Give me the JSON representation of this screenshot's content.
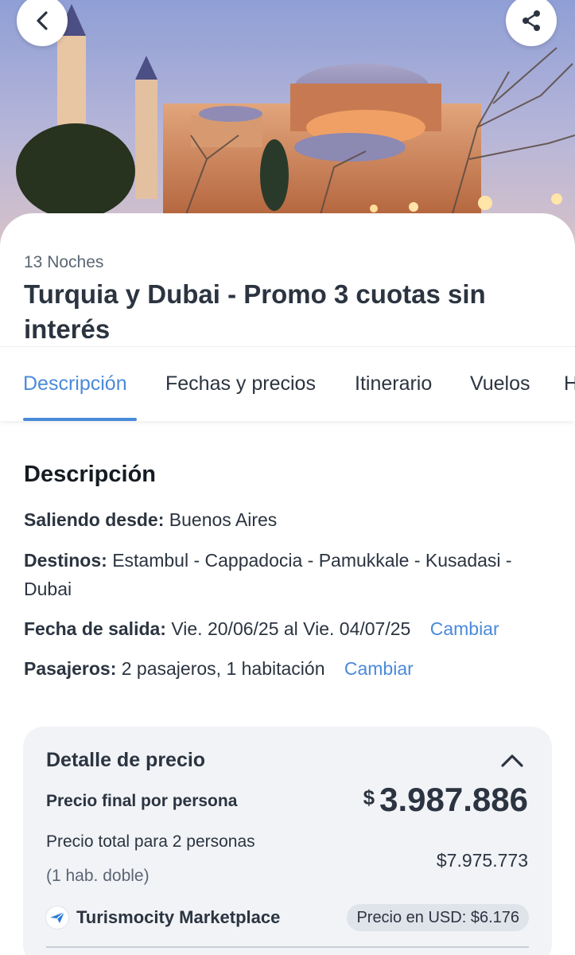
{
  "header": {
    "back_icon": "chevron-left-icon",
    "share_icon": "share-icon"
  },
  "package": {
    "nights": "13 Noches",
    "title": "Turquia y Dubai - Promo 3 cuotas sin interés"
  },
  "tabs": [
    {
      "label": "Descripción",
      "active": true
    },
    {
      "label": "Fechas y precios",
      "active": false
    },
    {
      "label": "Itinerario",
      "active": false
    },
    {
      "label": "Vuelos",
      "active": false
    },
    {
      "label": "H",
      "active": false
    }
  ],
  "description": {
    "heading": "Descripción",
    "origin_label": "Saliendo desde:",
    "origin_value": "Buenos Aires",
    "destinations_label": "Destinos:",
    "destinations_value": "Estambul - Cappadocia - Pamukkale - Kusadasi - Dubai",
    "date_label": "Fecha de salida:",
    "date_value": "Vie. 20/06/25 al Vie. 04/07/25",
    "date_change": "Cambiar",
    "passengers_label": "Pasajeros:",
    "passengers_value": "2 pasajeros, 1 habitación",
    "passengers_change": "Cambiar"
  },
  "price": {
    "title": "Detalle de precio",
    "per_person_label": "Precio final por persona",
    "currency": "$",
    "per_person_value": "3.987.886",
    "total_label": "Precio total para 2 personas",
    "total_sub": "(1 hab. doble)",
    "total_value": "$7.975.773",
    "brand": "Turismocity Marketplace",
    "usd": "Precio en USD: $6.176"
  },
  "colors": {
    "accent": "#4a8ad9",
    "text": "#2b3440",
    "card_bg": "#f1f3f7"
  }
}
